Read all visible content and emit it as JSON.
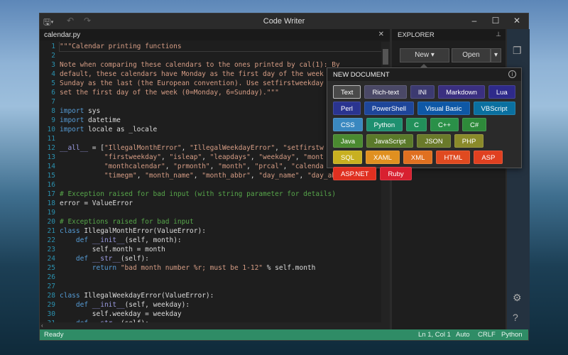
{
  "window": {
    "title": "Code Writer"
  },
  "editor": {
    "tab": "calendar.py",
    "lines": [
      [
        [
          "s",
          "\"\"\"Calendar printing functions"
        ]
      ],
      [],
      [
        [
          "s",
          "Note when comparing these calendars to the ones printed by cal(1): By"
        ]
      ],
      [
        [
          "s",
          "default, these calendars have Monday as the first day of the week"
        ]
      ],
      [
        [
          "s",
          "Sunday as the last (the European convention). Use setfirstweekday"
        ]
      ],
      [
        [
          "s",
          "set the first day of the week (0=Monday, 6=Sunday).\"\"\""
        ]
      ],
      [],
      [
        [
          "k",
          "import"
        ],
        [
          "i",
          " sys"
        ]
      ],
      [
        [
          "k",
          "import"
        ],
        [
          "i",
          " datetime"
        ]
      ],
      [
        [
          "k",
          "import"
        ],
        [
          "i",
          " locale as _locale"
        ]
      ],
      [],
      [
        [
          "d",
          "__all__"
        ],
        [
          "i",
          " = ["
        ],
        [
          "s",
          "\"IllegalMonthError\""
        ],
        [
          "i",
          ", "
        ],
        [
          "s",
          "\"IllegalWeekdayError\""
        ],
        [
          "i",
          ", "
        ],
        [
          "s",
          "\"setfirstw"
        ]
      ],
      [
        [
          "i",
          "           "
        ],
        [
          "s",
          "\"firstweekday\""
        ],
        [
          "i",
          ", "
        ],
        [
          "s",
          "\"isleap\""
        ],
        [
          "i",
          ", "
        ],
        [
          "s",
          "\"leapdays\""
        ],
        [
          "i",
          ", "
        ],
        [
          "s",
          "\"weekday\""
        ],
        [
          "i",
          ", "
        ],
        [
          "s",
          "\"mont"
        ]
      ],
      [
        [
          "i",
          "           "
        ],
        [
          "s",
          "\"monthcalendar\""
        ],
        [
          "i",
          ", "
        ],
        [
          "s",
          "\"prmonth\""
        ],
        [
          "i",
          ", "
        ],
        [
          "s",
          "\"month\""
        ],
        [
          "i",
          ", "
        ],
        [
          "s",
          "\"prcal\""
        ],
        [
          "i",
          ", "
        ],
        [
          "s",
          "\"calenda"
        ]
      ],
      [
        [
          "i",
          "           "
        ],
        [
          "s",
          "\"timegm\""
        ],
        [
          "i",
          ", "
        ],
        [
          "s",
          "\"month_name\""
        ],
        [
          "i",
          ", "
        ],
        [
          "s",
          "\"month_abbr\""
        ],
        [
          "i",
          ", "
        ],
        [
          "s",
          "\"day_name\""
        ],
        [
          "i",
          ", "
        ],
        [
          "s",
          "\"day_abbr\""
        ],
        [
          "i",
          "]"
        ]
      ],
      [],
      [
        [
          "c",
          "# Exception raised for bad input (with string parameter for details)"
        ]
      ],
      [
        [
          "i",
          "error = ValueError"
        ]
      ],
      [],
      [
        [
          "c",
          "# Exceptions raised for bad input"
        ]
      ],
      [
        [
          "k",
          "class"
        ],
        [
          "i",
          " IllegalMonthError(ValueError):"
        ]
      ],
      [
        [
          "i",
          "    "
        ],
        [
          "k",
          "def"
        ],
        [
          "i",
          " "
        ],
        [
          "d",
          "__init__"
        ],
        [
          "i",
          "(self, month):"
        ]
      ],
      [
        [
          "i",
          "        self.month = month"
        ]
      ],
      [
        [
          "i",
          "    "
        ],
        [
          "k",
          "def"
        ],
        [
          "i",
          " "
        ],
        [
          "d",
          "__str__"
        ],
        [
          "i",
          "(self):"
        ]
      ],
      [
        [
          "i",
          "        "
        ],
        [
          "k",
          "return"
        ],
        [
          "i",
          " "
        ],
        [
          "s",
          "\"bad month number %r; must be 1-12\""
        ],
        [
          "i",
          " % self.month"
        ]
      ],
      [],
      [],
      [
        [
          "k",
          "class"
        ],
        [
          "i",
          " IllegalWeekdayError(ValueError):"
        ]
      ],
      [
        [
          "i",
          "    "
        ],
        [
          "k",
          "def"
        ],
        [
          "i",
          " "
        ],
        [
          "d",
          "__init__"
        ],
        [
          "i",
          "(self, weekday):"
        ]
      ],
      [
        [
          "i",
          "        self.weekday = weekday"
        ]
      ],
      [
        [
          "i",
          "    "
        ],
        [
          "k",
          "def"
        ],
        [
          "i",
          " "
        ],
        [
          "d",
          "__str__"
        ],
        [
          "i",
          "(self):"
        ]
      ]
    ]
  },
  "explorer": {
    "title": "EXPLORER",
    "new_label": "New ▾",
    "open_label": "Open"
  },
  "popup": {
    "title": "NEW DOCUMENT",
    "items": [
      {
        "label": "Text",
        "color": "#4a4a4a"
      },
      {
        "label": "Rich-text",
        "color": "#4a4866"
      },
      {
        "label": "INI",
        "color": "#3c3a70"
      },
      {
        "label": "Markdown",
        "color": "#3a2f80"
      },
      {
        "label": "Lua",
        "color": "#2e2a8a"
      },
      {
        "label": "Perl",
        "color": "#2a3490"
      },
      {
        "label": "PowerShell",
        "color": "#1e469a"
      },
      {
        "label": "Visual Basic",
        "color": "#0e58a6"
      },
      {
        "label": "VBScript",
        "color": "#0a70a0"
      },
      {
        "label": "CSS",
        "color": "#3a88c0"
      },
      {
        "label": "Python",
        "color": "#1e9070"
      },
      {
        "label": "C",
        "color": "#22905a"
      },
      {
        "label": "C++",
        "color": "#2a9048"
      },
      {
        "label": "C#",
        "color": "#2e8a3a"
      },
      {
        "label": "Java",
        "color": "#4a8a30"
      },
      {
        "label": "JavaScript",
        "color": "#5a7a2a"
      },
      {
        "label": "JSON",
        "color": "#6a7a2a"
      },
      {
        "label": "PHP",
        "color": "#8a8a2a"
      },
      {
        "label": "SQL",
        "color": "#c8b020"
      },
      {
        "label": "XAML",
        "color": "#e09020"
      },
      {
        "label": "XML",
        "color": "#e07020"
      },
      {
        "label": "HTML",
        "color": "#e04a20"
      },
      {
        "label": "ASP",
        "color": "#e04020"
      },
      {
        "label": "ASP.NET",
        "color": "#e03020"
      },
      {
        "label": "Ruby",
        "color": "#d82030"
      }
    ]
  },
  "status": {
    "state": "Ready",
    "position": "Ln 1, Col 1",
    "encoding": "Auto",
    "line_ending": "CRLF",
    "language": "Python",
    "color": "#2f8c66"
  }
}
